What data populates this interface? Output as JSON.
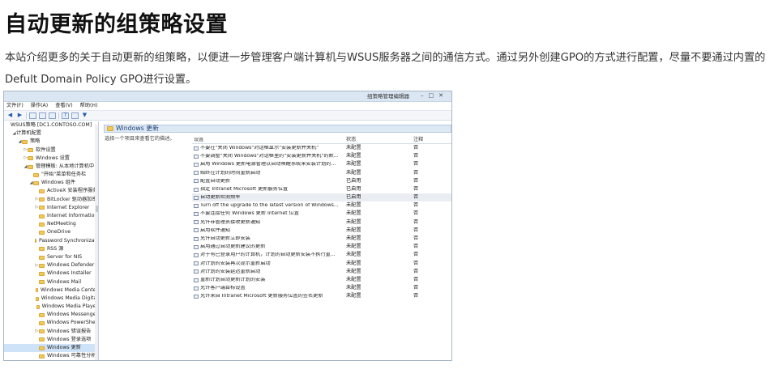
{
  "article": {
    "title": "自动更新的组策略设置",
    "intro": "本站介绍更多的关于自动更新的组策略，以便进一步管理客户端计算机与WSUS服务器之间的通信方式。通过另外创建GPO的方式进行配置，尽量不要通过内置的Defult Domain Policy GPO进行设置。"
  },
  "window": {
    "title": "组策略管理编辑器",
    "menu": [
      "文件(F)",
      "操作(A)",
      "查看(V)",
      "帮助(H)"
    ],
    "tree": [
      {
        "label": "WSUS策略 [DC1.CONTOSO.COM]",
        "indent": 0,
        "arrow": "",
        "folder": false
      },
      {
        "label": "计算机配置",
        "indent": 1,
        "arrow": "◢",
        "folder": false
      },
      {
        "label": "策略",
        "indent": 2,
        "arrow": "◢",
        "folder": true
      },
      {
        "label": "软件设置",
        "indent": 3,
        "arrow": "▷",
        "folder": true
      },
      {
        "label": "Windows 设置",
        "indent": 3,
        "arrow": "▷",
        "folder": true
      },
      {
        "label": "管理模板: 从本地计算机中",
        "indent": 3,
        "arrow": "◢",
        "folder": true
      },
      {
        "label": "\"开始\"菜单和任务栏",
        "indent": 4,
        "arrow": "",
        "folder": true
      },
      {
        "label": "Windows 组件",
        "indent": 4,
        "arrow": "◢",
        "folder": true
      },
      {
        "label": "ActiveX 安装程序服务",
        "indent": 5,
        "arrow": "",
        "folder": true
      },
      {
        "label": "BitLocker 驱动器加密",
        "indent": 5,
        "arrow": "▷",
        "folder": true
      },
      {
        "label": "Internet Explorer",
        "indent": 5,
        "arrow": "▷",
        "folder": true
      },
      {
        "label": "Internet Information",
        "indent": 5,
        "arrow": "",
        "folder": true
      },
      {
        "label": "NetMeeting",
        "indent": 5,
        "arrow": "",
        "folder": true
      },
      {
        "label": "OneDrive",
        "indent": 5,
        "arrow": "",
        "folder": true
      },
      {
        "label": "Password Synchronization",
        "indent": 5,
        "arrow": "",
        "folder": true
      },
      {
        "label": "RSS 源",
        "indent": 5,
        "arrow": "",
        "folder": true
      },
      {
        "label": "Server for NIS",
        "indent": 5,
        "arrow": "",
        "folder": true
      },
      {
        "label": "Windows Defender",
        "indent": 5,
        "arrow": "▷",
        "folder": true
      },
      {
        "label": "Windows Installer",
        "indent": 5,
        "arrow": "",
        "folder": true
      },
      {
        "label": "Windows Mail",
        "indent": 5,
        "arrow": "",
        "folder": true
      },
      {
        "label": "Windows Media Center",
        "indent": 5,
        "arrow": "",
        "folder": true
      },
      {
        "label": "Windows Media Digital",
        "indent": 5,
        "arrow": "",
        "folder": true
      },
      {
        "label": "Windows Media Player",
        "indent": 5,
        "arrow": "",
        "folder": true
      },
      {
        "label": "Windows Messenger",
        "indent": 5,
        "arrow": "",
        "folder": true
      },
      {
        "label": "Windows PowerShell",
        "indent": 5,
        "arrow": "",
        "folder": true
      },
      {
        "label": "Windows 错误报告",
        "indent": 5,
        "arrow": "▷",
        "folder": true
      },
      {
        "label": "Windows 登录选项",
        "indent": 5,
        "arrow": "",
        "folder": true
      },
      {
        "label": "Windows 更新",
        "indent": 5,
        "arrow": "",
        "folder": true,
        "selected": true
      },
      {
        "label": "Windows 可靠性分析",
        "indent": 5,
        "arrow": "",
        "folder": true
      }
    ],
    "pane_title": "Windows 更新",
    "pane_desc": "选择一个项目来查看它的描述。",
    "columns": [
      "设置",
      "状态",
      "注释"
    ],
    "rows": [
      {
        "setting": "不要在\"关闭 Windows\"对话框显示\"安装更新并关机\"",
        "state": "未配置",
        "note": "否"
      },
      {
        "setting": "不要调整\"关闭 Windows\"对话框里的\"安装更新并关机\"的默...",
        "state": "未配置",
        "note": "否"
      },
      {
        "setting": "启用 Windows 更新电源管理以自动唤醒系统来安装计划的...",
        "state": "未配置",
        "note": "否"
      },
      {
        "setting": "始终在计划的时间重新启动",
        "state": "未配置",
        "note": "否"
      },
      {
        "setting": "配置自动更新",
        "state": "已启用",
        "note": "否"
      },
      {
        "setting": "指定 Intranet Microsoft 更新服务位置",
        "state": "已启用",
        "note": "否"
      },
      {
        "setting": "自动更新检测频率",
        "state": "已启用",
        "note": "否",
        "selected": true
      },
      {
        "setting": "Turn off the upgrade to the latest version of Windows...",
        "state": "未配置",
        "note": "否"
      },
      {
        "setting": "不要连接任何 Windows 更新 Internet 位置",
        "state": "未配置",
        "note": "否"
      },
      {
        "setting": "允许非管理员接收更新通知",
        "state": "未配置",
        "note": "否"
      },
      {
        "setting": "启用软件通知",
        "state": "未配置",
        "note": "否"
      },
      {
        "setting": "允许自动更新立即安装",
        "state": "未配置",
        "note": "否"
      },
      {
        "setting": "启用通过自动更新建议的更新",
        "state": "未配置",
        "note": "否"
      },
      {
        "setting": "对于有已登录用户的计算机，计划的自动更新安装不执行重...",
        "state": "未配置",
        "note": "否"
      },
      {
        "setting": "对计划的安装再次提示重新启动",
        "state": "未配置",
        "note": "否"
      },
      {
        "setting": "对计划的安装延迟重新启动",
        "state": "未配置",
        "note": "否"
      },
      {
        "setting": "重新计划自动更新计划的安装",
        "state": "未配置",
        "note": "否"
      },
      {
        "setting": "允许客户端目标设置",
        "state": "未配置",
        "note": "否"
      },
      {
        "setting": "允许来自 Intranet Microsoft 更新服务位置的签名更新",
        "state": "未配置",
        "note": "否"
      }
    ]
  }
}
